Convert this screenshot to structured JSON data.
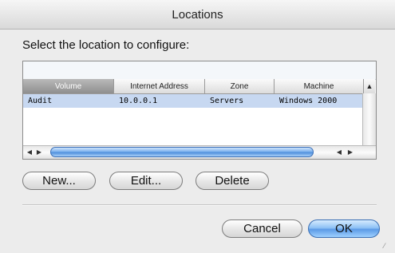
{
  "window": {
    "title": "Locations"
  },
  "prompt": "Select the location to configure:",
  "table": {
    "columns": [
      "Volume",
      "Internet Address",
      "Zone",
      "Machine"
    ],
    "sorted_column": "Volume",
    "rows": [
      {
        "volume": "Audit",
        "address": "10.0.0.1",
        "zone": "Servers",
        "machine": "Windows 2000",
        "selected": true
      }
    ]
  },
  "buttons": {
    "new": "New...",
    "edit": "Edit...",
    "delete": "Delete",
    "cancel": "Cancel",
    "ok": "OK"
  },
  "colors": {
    "selected_row": "#c7d8f1",
    "default_button": "#5c9be6"
  },
  "icons": {
    "sort_corner": "triangle-up",
    "hscroll_left": "arrow-left",
    "hscroll_right": "arrow-right"
  }
}
